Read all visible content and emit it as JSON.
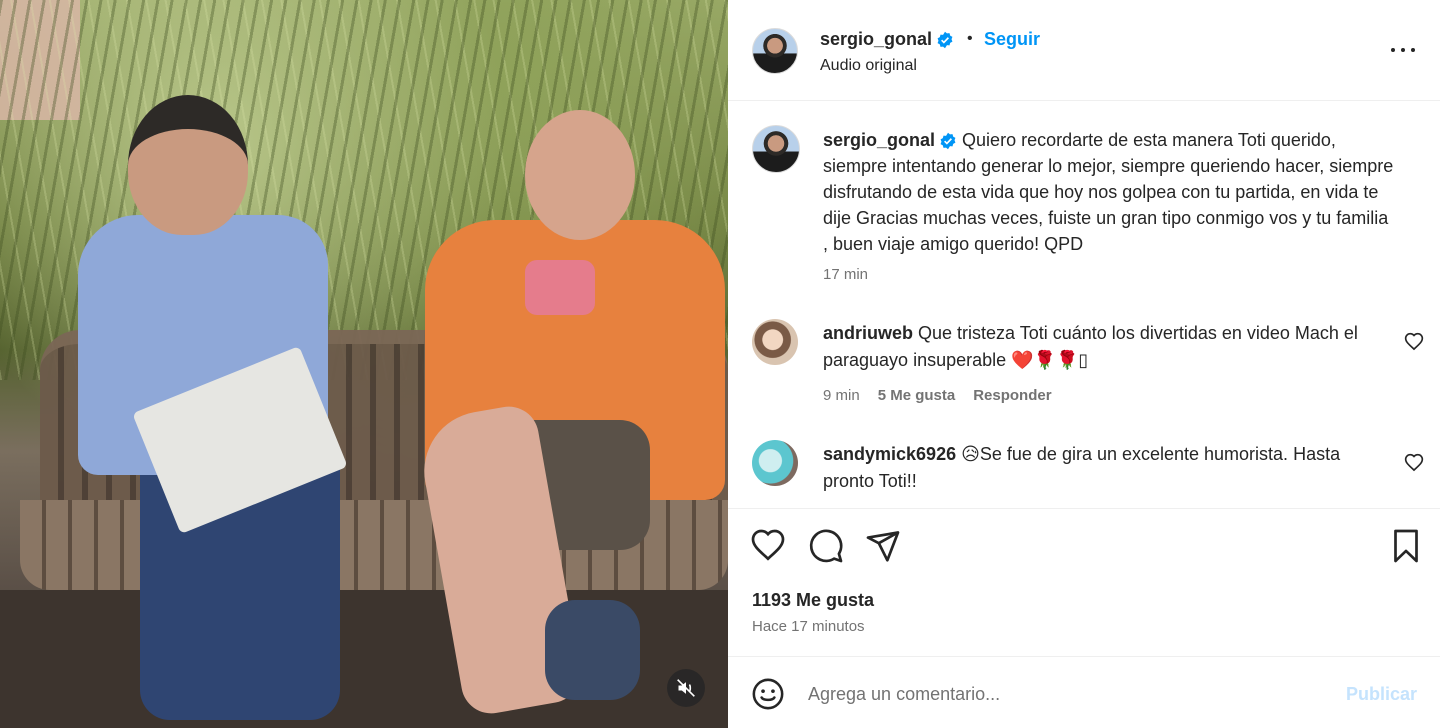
{
  "post": {
    "username": "sergio_gonal",
    "follow_label": "Seguir",
    "separator": "•",
    "audio_label": "Audio original"
  },
  "caption": {
    "username": "sergio_gonal",
    "text": "Quiero recordarte de esta manera Toti querido, siempre intentando generar lo mejor, siempre queriendo hacer, siempre disfrutando de esta vida que hoy nos golpea con tu partida, en vida te dije Gracias muchas veces, fuiste un gran tipo conmigo vos y tu familia , buen viaje amigo querido! QPD",
    "time": "17 min"
  },
  "comments": [
    {
      "username": "andriuweb",
      "text": "Que tristeza Toti cuánto los divertidas en video Mach el paraguayo insuperable ❤️🌹🌹▯",
      "time": "9 min",
      "likes": "5 Me gusta",
      "reply_label": "Responder"
    },
    {
      "username": "sandymick6926",
      "text": "😥Se fue de gira un excelente humorista. Hasta pronto Toti!!"
    }
  ],
  "stats": {
    "likes": "1193 Me gusta",
    "time_ago": "Hace 17 minutos"
  },
  "composer": {
    "placeholder": "Agrega un comentario...",
    "publish_label": "Publicar"
  },
  "colors": {
    "accent": "#0095f6",
    "verified": "#0095f6",
    "publish_disabled": "#c5e3fd",
    "muted_text": "#737373"
  },
  "icons": {
    "verified": "verified-badge-icon",
    "more": "more-options-icon",
    "like": "heart-icon",
    "comment": "comment-icon",
    "share": "send-icon",
    "save": "bookmark-icon",
    "emoji": "emoji-icon",
    "mute": "muted-speaker-icon"
  }
}
